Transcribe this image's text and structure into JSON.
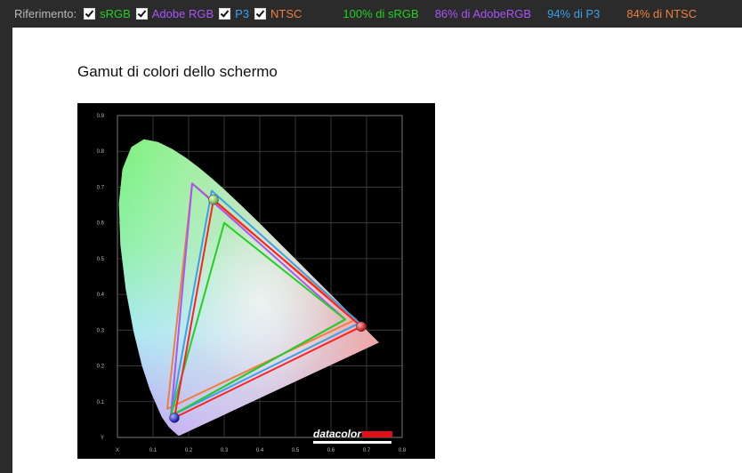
{
  "toolbar": {
    "label": "Riferimento:",
    "references": [
      {
        "label": "sRGB",
        "color": "#22d022",
        "checked": true
      },
      {
        "label": "Adobe RGB",
        "color": "#a855f7",
        "checked": true
      },
      {
        "label": "P3",
        "color": "#3aa0e8",
        "checked": true
      },
      {
        "label": "NTSC",
        "color": "#f07f3c",
        "checked": true
      }
    ],
    "stats": [
      {
        "text": "100% di sRGB",
        "color": "#22d022"
      },
      {
        "text": "86% di AdobeRGB",
        "color": "#a855f7"
      },
      {
        "text": "94% di P3",
        "color": "#3aa0e8"
      },
      {
        "text": "84% di NTSC",
        "color": "#f07f3c"
      }
    ]
  },
  "page": {
    "title": "Gamut di colori dello schermo"
  },
  "chart_data": {
    "type": "scatter",
    "xlim": [
      0,
      0.8
    ],
    "ylim": [
      0,
      0.9
    ],
    "x_ticks": [
      "X",
      "0.1",
      "0.2",
      "0.3",
      "0.4",
      "0.5",
      "0.6",
      "0.7",
      "0.8"
    ],
    "y_ticks": [
      "Y",
      "0.1",
      "0.2",
      "0.3",
      "0.4",
      "0.5",
      "0.6",
      "0.7",
      "0.8",
      "0.9"
    ],
    "grid": true,
    "logo": "datacolor",
    "triangles": [
      {
        "color": "#f07f3c",
        "points": [
          [
            0.14,
            0.08
          ],
          [
            0.67,
            0.33
          ],
          [
            0.21,
            0.71
          ]
        ]
      },
      {
        "color": "#a855f7",
        "points": [
          [
            0.15,
            0.06
          ],
          [
            0.64,
            0.33
          ],
          [
            0.21,
            0.71
          ]
        ]
      },
      {
        "color": "#3aa0e8",
        "points": [
          [
            0.15,
            0.06
          ],
          [
            0.68,
            0.32
          ],
          [
            0.265,
            0.69
          ]
        ]
      },
      {
        "color": "#22d022",
        "points": [
          [
            0.15,
            0.06
          ],
          [
            0.64,
            0.33
          ],
          [
            0.3,
            0.6
          ]
        ]
      },
      {
        "color": "#ff2020",
        "points": [
          [
            0.16,
            0.055
          ],
          [
            0.685,
            0.31
          ],
          [
            0.27,
            0.665
          ]
        ]
      }
    ],
    "primaries": [
      {
        "x": 0.685,
        "y": 0.31,
        "color": "#e02020"
      },
      {
        "x": 0.27,
        "y": 0.665,
        "color": "#7ac143"
      },
      {
        "x": 0.16,
        "y": 0.055,
        "color": "#2a2ae0"
      }
    ]
  }
}
